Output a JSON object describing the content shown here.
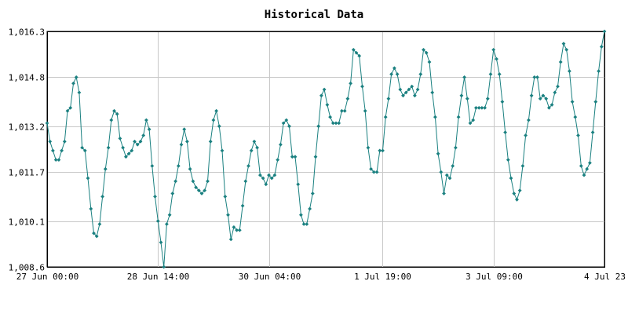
{
  "chart_data": {
    "type": "line",
    "title": "Historical Data",
    "xlabel": "",
    "ylabel": "",
    "ylim": [
      1008.6,
      1016.3
    ],
    "y_ticks": [
      "1,008.6",
      "1,010.1",
      "1,011.7",
      "1,013.2",
      "1,014.8",
      "1,016.3"
    ],
    "y_tick_values": [
      1008.6,
      1010.1,
      1011.7,
      1013.2,
      1014.8,
      1016.3
    ],
    "x_ticks": [
      "27 Jun 00:00",
      "28 Jun 14:00",
      "30 Jun 04:00",
      "1 Jul 19:00",
      "3 Jul 09:00",
      "4 Jul 23"
    ],
    "x_hours_from_start": [
      0,
      38,
      76,
      115,
      153,
      191
    ],
    "grid": true,
    "legend": "none",
    "color": "#1a8080",
    "series": [
      {
        "values": [
          1013.3,
          1012.7,
          1012.4,
          1012.1,
          1012.1,
          1012.4,
          1012.7,
          1013.7,
          1013.8,
          1014.6,
          1014.8,
          1014.3,
          1012.5,
          1012.4,
          1011.5,
          1010.5,
          1009.7,
          1009.6,
          1010.0,
          1010.9,
          1011.8,
          1012.5,
          1013.4,
          1013.7,
          1013.6,
          1012.8,
          1012.5,
          1012.2,
          1012.3,
          1012.4,
          1012.7,
          1012.6,
          1012.7,
          1012.9,
          1013.4,
          1013.1,
          1011.9,
          1010.9,
          1010.1,
          1009.4,
          1008.6,
          1010.0,
          1010.3,
          1011.0,
          1011.4,
          1011.9,
          1012.6,
          1013.1,
          1012.7,
          1011.8,
          1011.4,
          1011.2,
          1011.1,
          1011.0,
          1011.1,
          1011.4,
          1012.7,
          1013.4,
          1013.7,
          1013.2,
          1012.4,
          1010.9,
          1010.3,
          1009.5,
          1009.9,
          1009.8,
          1009.8,
          1010.6,
          1011.4,
          1011.9,
          1012.4,
          1012.7,
          1012.5,
          1011.6,
          1011.5,
          1011.3,
          1011.6,
          1011.5,
          1011.6,
          1012.1,
          1012.6,
          1013.3,
          1013.4,
          1013.2,
          1012.2,
          1012.2,
          1011.3,
          1010.3,
          1010.0,
          1010.0,
          1010.5,
          1011.0,
          1012.2,
          1013.2,
          1014.2,
          1014.4,
          1013.9,
          1013.5,
          1013.3,
          1013.3,
          1013.3,
          1013.7,
          1013.7,
          1014.1,
          1014.6,
          1015.7,
          1015.6,
          1015.5,
          1014.5,
          1013.7,
          1012.5,
          1011.8,
          1011.7,
          1011.7,
          1012.4,
          1012.4,
          1013.5,
          1014.1,
          1014.9,
          1015.1,
          1014.9,
          1014.4,
          1014.2,
          1014.3,
          1014.4,
          1014.5,
          1014.2,
          1014.4,
          1014.9,
          1015.7,
          1015.6,
          1015.3,
          1014.3,
          1013.5,
          1012.3,
          1011.7,
          1011.0,
          1011.6,
          1011.5,
          1011.9,
          1012.5,
          1013.5,
          1014.2,
          1014.8,
          1014.1,
          1013.3,
          1013.4,
          1013.8,
          1013.8,
          1013.8,
          1013.8,
          1014.1,
          1014.9,
          1015.7,
          1015.4,
          1014.9,
          1014.0,
          1013.0,
          1012.1,
          1011.5,
          1011.0,
          1010.8,
          1011.1,
          1011.9,
          1012.9,
          1013.4,
          1014.2,
          1014.8,
          1014.8,
          1014.1,
          1014.2,
          1014.1,
          1013.8,
          1013.9,
          1014.3,
          1014.5,
          1015.3,
          1015.9,
          1015.7,
          1015.0,
          1014.0,
          1013.5,
          1012.9,
          1011.9,
          1011.6,
          1011.8,
          1012.0,
          1013.0,
          1014.0,
          1015.0,
          1015.8,
          1016.3
        ]
      }
    ]
  }
}
